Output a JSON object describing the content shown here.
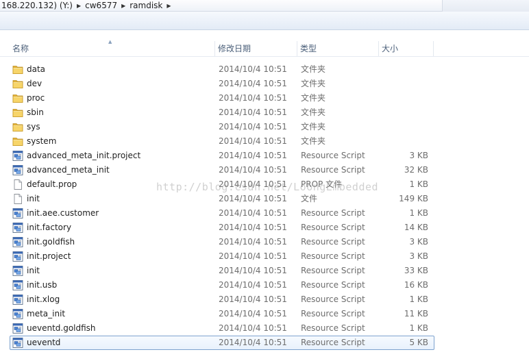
{
  "address": {
    "crumbs": [
      "168.220.132) (Y:)",
      "cw6577",
      "ramdisk"
    ]
  },
  "columns": {
    "name": "名称",
    "date": "修改日期",
    "type": "类型",
    "size": "大小"
  },
  "files": [
    {
      "name": "data",
      "date": "2014/10/4 10:51",
      "type": "文件夹",
      "size": "",
      "icon": "folder-icon"
    },
    {
      "name": "dev",
      "date": "2014/10/4 10:51",
      "type": "文件夹",
      "size": "",
      "icon": "folder-icon"
    },
    {
      "name": "proc",
      "date": "2014/10/4 10:51",
      "type": "文件夹",
      "size": "",
      "icon": "folder-icon"
    },
    {
      "name": "sbin",
      "date": "2014/10/4 10:51",
      "type": "文件夹",
      "size": "",
      "icon": "folder-icon"
    },
    {
      "name": "sys",
      "date": "2014/10/4 10:51",
      "type": "文件夹",
      "size": "",
      "icon": "folder-icon"
    },
    {
      "name": "system",
      "date": "2014/10/4 10:51",
      "type": "文件夹",
      "size": "",
      "icon": "folder-icon"
    },
    {
      "name": "advanced_meta_init.project",
      "date": "2014/10/4 10:51",
      "type": "Resource Script",
      "size": "3 KB",
      "icon": "script-file-icon"
    },
    {
      "name": "advanced_meta_init",
      "date": "2014/10/4 10:51",
      "type": "Resource Script",
      "size": "32 KB",
      "icon": "script-file-icon"
    },
    {
      "name": "default.prop",
      "date": "2014/10/4 10:51",
      "type": "PROP 文件",
      "size": "1 KB",
      "icon": "blank-file-icon"
    },
    {
      "name": "init",
      "date": "2014/10/4 10:51",
      "type": "文件",
      "size": "149 KB",
      "icon": "blank-file-icon"
    },
    {
      "name": "init.aee.customer",
      "date": "2014/10/4 10:51",
      "type": "Resource Script",
      "size": "1 KB",
      "icon": "script-file-icon"
    },
    {
      "name": "init.factory",
      "date": "2014/10/4 10:51",
      "type": "Resource Script",
      "size": "14 KB",
      "icon": "script-file-icon"
    },
    {
      "name": "init.goldfish",
      "date": "2014/10/4 10:51",
      "type": "Resource Script",
      "size": "3 KB",
      "icon": "script-file-icon"
    },
    {
      "name": "init.project",
      "date": "2014/10/4 10:51",
      "type": "Resource Script",
      "size": "3 KB",
      "icon": "script-file-icon"
    },
    {
      "name": "init",
      "date": "2014/10/4 10:51",
      "type": "Resource Script",
      "size": "33 KB",
      "icon": "script-file-icon"
    },
    {
      "name": "init.usb",
      "date": "2014/10/4 10:51",
      "type": "Resource Script",
      "size": "16 KB",
      "icon": "script-file-icon"
    },
    {
      "name": "init.xlog",
      "date": "2014/10/4 10:51",
      "type": "Resource Script",
      "size": "1 KB",
      "icon": "script-file-icon"
    },
    {
      "name": "meta_init",
      "date": "2014/10/4 10:51",
      "type": "Resource Script",
      "size": "11 KB",
      "icon": "script-file-icon"
    },
    {
      "name": "ueventd.goldfish",
      "date": "2014/10/4 10:51",
      "type": "Resource Script",
      "size": "1 KB",
      "icon": "script-file-icon"
    },
    {
      "name": "ueventd",
      "date": "2014/10/4 10:51",
      "type": "Resource Script",
      "size": "5 KB",
      "icon": "script-file-icon",
      "selected": true
    }
  ],
  "watermark": "http://blog.csdn.net/LoongEmbedded"
}
